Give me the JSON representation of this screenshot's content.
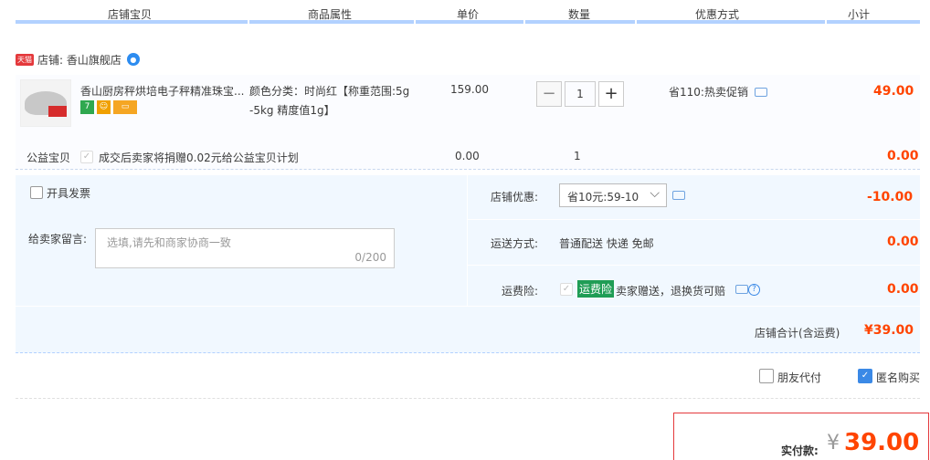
{
  "columns": [
    "店铺宝贝",
    "商品属性",
    "单价",
    "数量",
    "优惠方式",
    "小计"
  ],
  "shop": {
    "tmall_badge": "天猫",
    "label": "店铺: 香山旗舰店",
    "ww_icon": "chat-bubble-icon"
  },
  "item": {
    "title": "香山厨房秤烘培电子秤精准珠宝...",
    "badges": [
      {
        "text": "7",
        "color": "#2fa84f"
      },
      {
        "text": "☺",
        "color": "#f0a000"
      },
      {
        "text": "▭",
        "color": "#f5a623"
      }
    ],
    "attr_line1": "颜色分类：时尚红【称重范围:5g",
    "attr_line2": "-5kg 精度值1g】",
    "price": "159.00",
    "qty_minus": "−",
    "qty": "1",
    "qty_plus": "+",
    "discount": "省110:热卖促销",
    "subtotal": "49.00"
  },
  "charity": {
    "label": "公益宝贝",
    "desc": "成交后卖家将捐赠0.02元给公益宝贝计划",
    "price": "0.00",
    "qty": "1",
    "subtotal": "0.00"
  },
  "invoice": {
    "label": "开具发票"
  },
  "message": {
    "label": "给卖家留言:",
    "placeholder": "选填,请先和商家协商一致",
    "counter": "0/200"
  },
  "shop_discount": {
    "label": "店铺优惠:",
    "selected": "省10元:59-10",
    "amount": "-10.00"
  },
  "shipping": {
    "label": "运送方式:",
    "value": "普通配送 快递 免邮",
    "amount": "0.00"
  },
  "insurance": {
    "label": "运费险:",
    "tag": "运费险",
    "desc": "卖家赠送，退换货可赔",
    "amount": "0.00"
  },
  "shop_total": {
    "label": "店铺合计(含运费)",
    "amount": "¥39.00"
  },
  "options": {
    "friend_pay": "朋友代付",
    "anonymous": "匿名购买"
  },
  "payment": {
    "label": "实付款:",
    "currency": "¥",
    "amount": "39.00"
  },
  "colors": {
    "accent_red": "#f40",
    "header_underline": "#b2d1ff",
    "tag_green": "#1f9d55"
  }
}
